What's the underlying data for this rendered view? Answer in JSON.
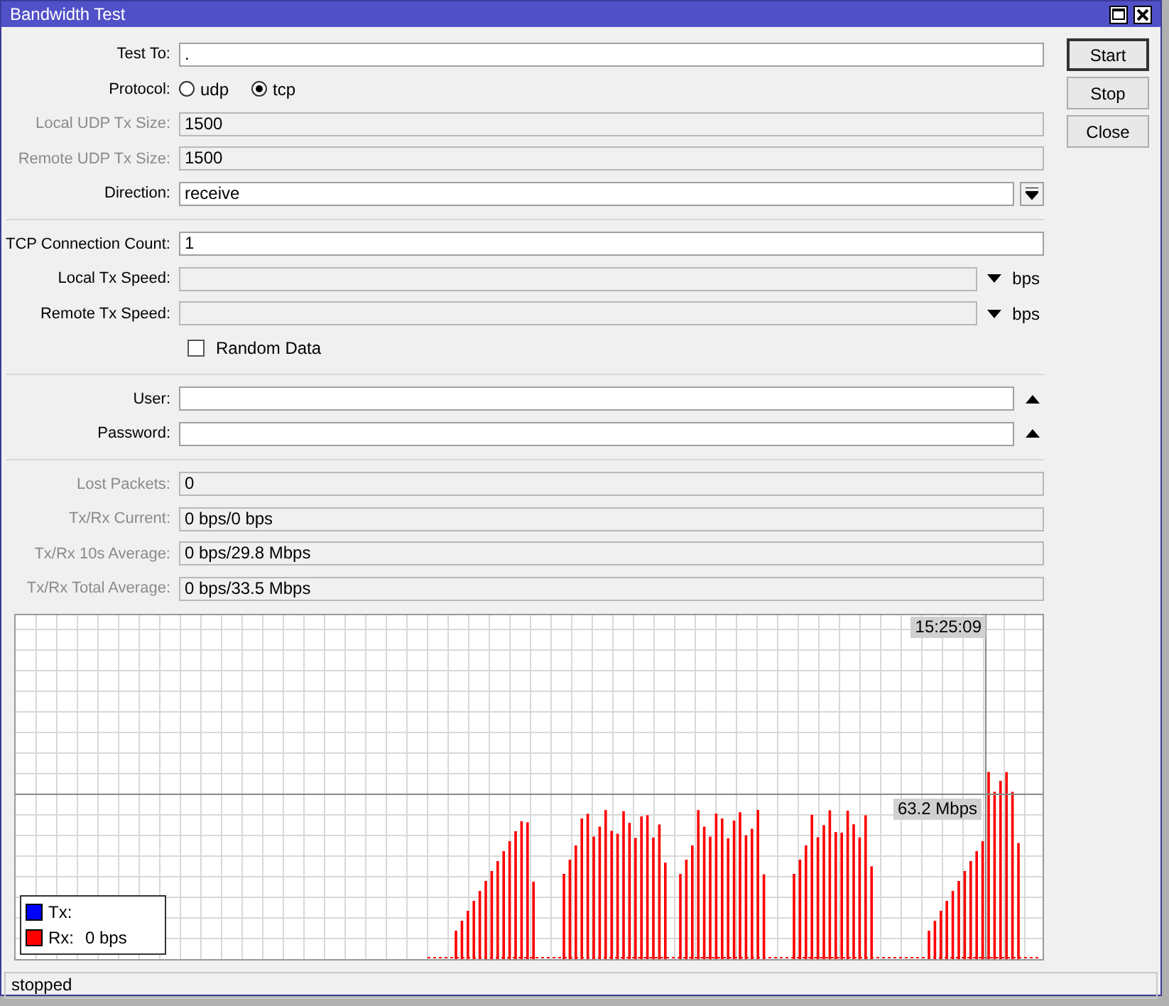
{
  "window": {
    "title": "Bandwidth Test"
  },
  "sections": [
    {
      "fields": [
        {
          "kind": "text",
          "label": "Test To:",
          "value": ".",
          "disabled": false
        },
        {
          "kind": "radio",
          "label": "Protocol:",
          "options": [
            {
              "label": "udp",
              "selected": false
            },
            {
              "label": "tcp",
              "selected": true
            }
          ]
        },
        {
          "kind": "text",
          "label": "Local UDP Tx Size:",
          "value": "1500",
          "disabled": true
        },
        {
          "kind": "text",
          "label": "Remote UDP Tx Size:",
          "value": "1500",
          "disabled": true
        },
        {
          "kind": "select",
          "label": "Direction:",
          "value": "receive"
        }
      ]
    },
    {
      "fields": [
        {
          "kind": "text",
          "label": "TCP Connection Count:",
          "value": "1",
          "disabled": false
        },
        {
          "kind": "speed",
          "label": "Local Tx Speed:",
          "unit": "bps"
        },
        {
          "kind": "speed",
          "label": "Remote Tx Speed:",
          "unit": "bps"
        },
        {
          "kind": "checkbox",
          "label": "Random Data",
          "checked": false
        }
      ]
    },
    {
      "fields": [
        {
          "kind": "optional",
          "label": "User:"
        },
        {
          "kind": "optional",
          "label": "Password:"
        }
      ]
    },
    {
      "fields": [
        {
          "kind": "text",
          "label": "Lost Packets:",
          "value": "0",
          "disabled": true
        },
        {
          "kind": "text",
          "label": "Tx/Rx Current:",
          "value": "0 bps/0 bps",
          "disabled": true
        },
        {
          "kind": "text",
          "label": "Tx/Rx 10s Average:",
          "value": "0 bps/29.8 Mbps",
          "disabled": true
        },
        {
          "kind": "text",
          "label": "Tx/Rx Total Average:",
          "value": "0 bps/33.5 Mbps",
          "disabled": true
        }
      ]
    }
  ],
  "graph": {
    "time_label": "15:25:09",
    "value_label": "63.2 Mbps",
    "legend": [
      {
        "label": "Tx:",
        "color": "#0000ff"
      },
      {
        "label": "Rx:",
        "reading": "0 bps",
        "color": "#ff0000"
      }
    ]
  },
  "buttons": [
    {
      "label": "Start",
      "default": true
    },
    {
      "label": "Stop",
      "default": false
    },
    {
      "label": "Close",
      "default": false
    }
  ],
  "status_bar": "stopped"
}
